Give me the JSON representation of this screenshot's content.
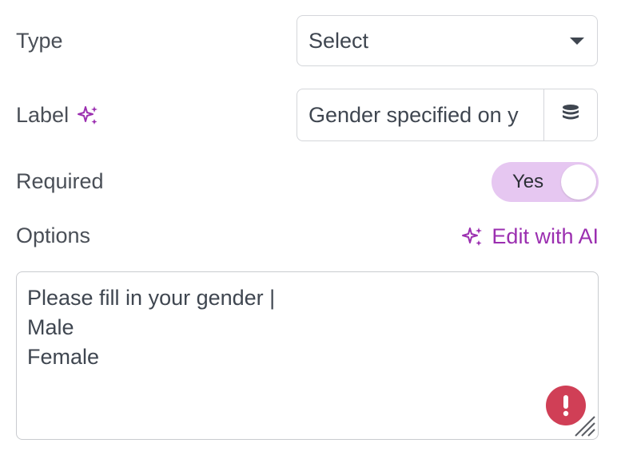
{
  "fields": {
    "type": {
      "label": "Type",
      "select_value": "Select"
    },
    "label": {
      "label": "Label",
      "value": "Gender specified on y"
    },
    "required": {
      "label": "Required",
      "toggle_text": "Yes",
      "toggle_on": true
    },
    "options": {
      "label": "Options",
      "edit_ai_label": "Edit with AI",
      "lines": [
        "Please fill in your gender |",
        "Male",
        "Female"
      ]
    }
  },
  "icons": {
    "sparkle": "sparkle-icon",
    "database": "database-icon",
    "caret": "caret-down-icon",
    "error": "error-icon",
    "resize": "resize-handle-icon"
  },
  "colors": {
    "accent": "#9b2fb0",
    "toggle_bg": "#e6c7f1",
    "error": "#d03f56",
    "border": "#d4d6da",
    "text": "#3f4650"
  }
}
